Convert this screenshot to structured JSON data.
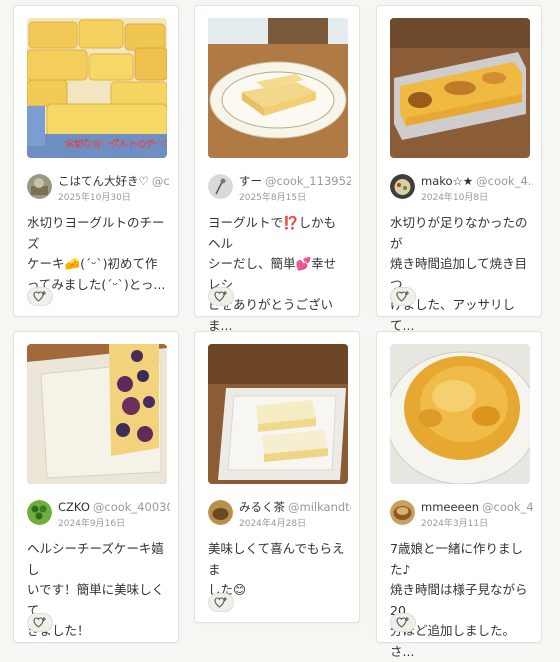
{
  "cards": [
    {
      "name": "こはてん大好き♡",
      "id": "@c...",
      "date": "2025年10月30日",
      "comment": "水切りヨーグルトのチーズ\nケーキ🧀(ˊᵕˋ)初めて作\nってみました(ˊᵕˋ)とっ...",
      "photo_caption": "水切りヨーグルトのチーズ"
    },
    {
      "name": "すー",
      "id": "@cook_113952...",
      "date": "2025年8月15日",
      "comment": "ヨーグルトで⁉️しかもヘル\nシーだし、簡単💕幸せレシ\nピをありがとうございま..."
    },
    {
      "name": "mako☆★",
      "id": "@cook_4...",
      "date": "2024年10月8日",
      "comment": "水切りが足りなかったのが\n焼き時間追加して焼き目つ\nけました、アッサリして..."
    },
    {
      "name": "CZKO",
      "id": "@cook_40030...",
      "date": "2024年9月16日",
      "comment": "ヘルシーチーズケーキ嬉し\nいです！簡単に美味しくて\nきました！"
    },
    {
      "name": "みるく茶",
      "id": "@milkandtea",
      "date": "2024年4月28日",
      "comment": "美味しくて喜んでもらえま\nした😊"
    },
    {
      "name": "mmeeeen",
      "id": "@cook_4...",
      "date": "2024年3月11日",
      "comment": "7歳娘と一緒に作りました♪\n焼き時間は様子見ながら20\n分ほど追加しました。さ..."
    }
  ]
}
